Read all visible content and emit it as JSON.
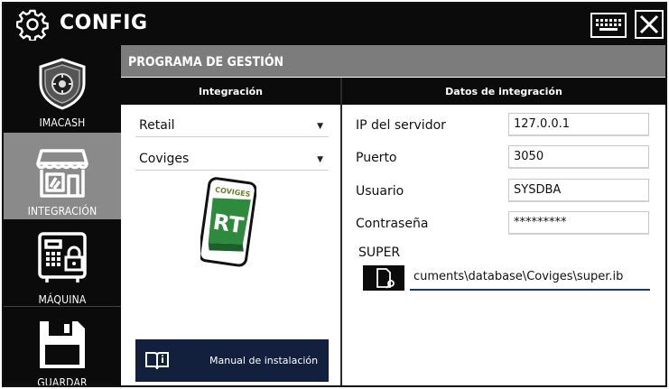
{
  "window": {
    "title": "CONFIG"
  },
  "sidebar": {
    "items": [
      {
        "label": "IMACASH",
        "icon": "shield-icon"
      },
      {
        "label": "INTEGRACIÓN",
        "icon": "store-icon",
        "active": true
      },
      {
        "label": "MÁQUINA",
        "icon": "safe-icon"
      },
      {
        "label": "GUARDAR",
        "icon": "save-icon"
      }
    ]
  },
  "section": {
    "title": "PROGRAMA DE GESTIÓN"
  },
  "integration": {
    "header": "Integración",
    "type_select": "Retail",
    "program_select": "Coviges",
    "logo_text": "COVIGES",
    "logo_badge": "RT",
    "manual_button": "Manual de instalación"
  },
  "details": {
    "header": "Datos de integración",
    "fields": [
      {
        "label": "IP del servidor",
        "value": "127.0.0.1"
      },
      {
        "label": "Puerto",
        "value": "3050"
      },
      {
        "label": "Usuario",
        "value": "SYSDBA"
      },
      {
        "label": "Contraseña",
        "value": "*********"
      }
    ],
    "super_label": "SUPER",
    "super_path": "cuments\\database\\Coviges\\super.ib"
  },
  "colors": {
    "titlebar": "#0b0b0b",
    "header_gray": "#7c7c7c",
    "active_item": "#8a8a8a",
    "manual_button": "#12203d",
    "logo_green": "#2e8b3e"
  }
}
